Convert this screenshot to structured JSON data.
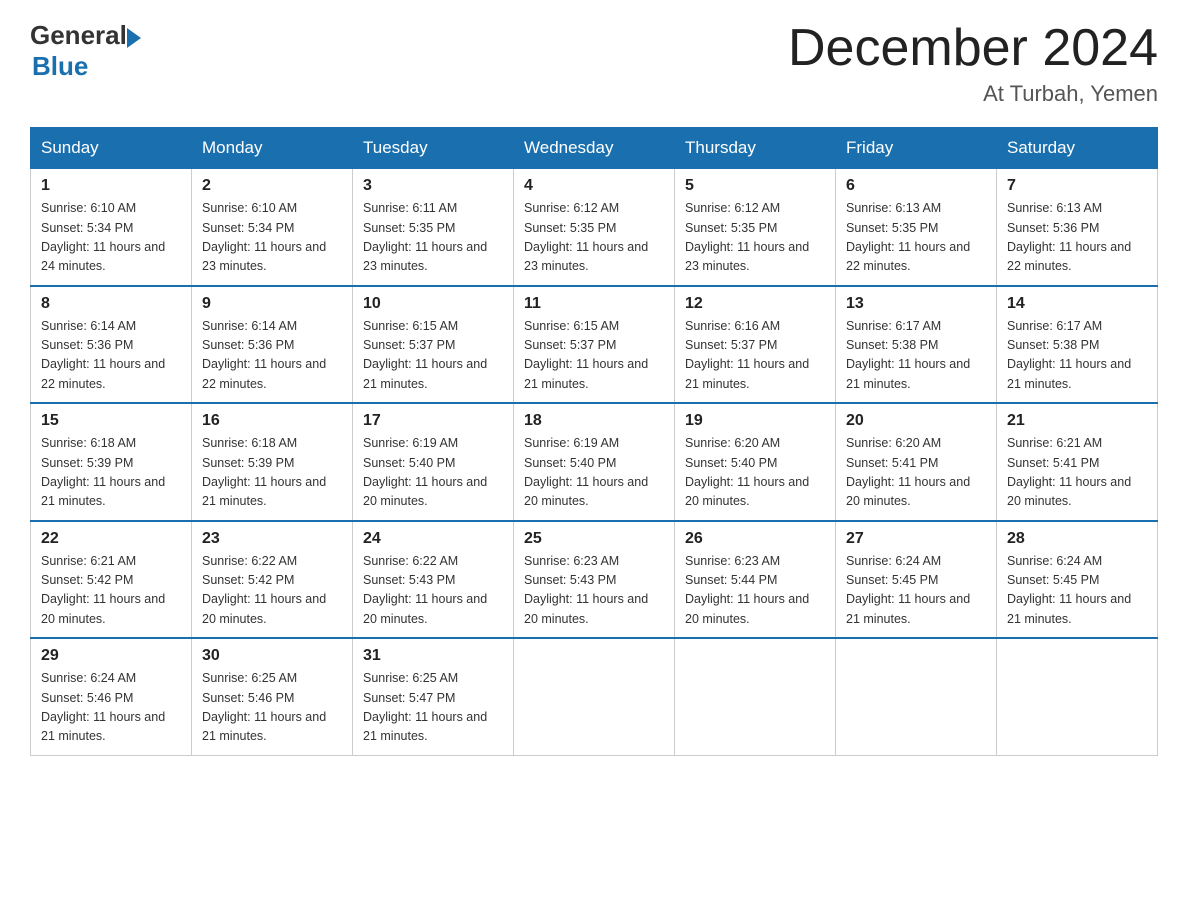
{
  "header": {
    "logo_general": "General",
    "logo_blue": "Blue",
    "month_title": "December 2024",
    "location": "At Turbah, Yemen"
  },
  "days_of_week": [
    "Sunday",
    "Monday",
    "Tuesday",
    "Wednesday",
    "Thursday",
    "Friday",
    "Saturday"
  ],
  "weeks": [
    [
      {
        "day": "1",
        "sunrise": "6:10 AM",
        "sunset": "5:34 PM",
        "daylight": "11 hours and 24 minutes."
      },
      {
        "day": "2",
        "sunrise": "6:10 AM",
        "sunset": "5:34 PM",
        "daylight": "11 hours and 23 minutes."
      },
      {
        "day": "3",
        "sunrise": "6:11 AM",
        "sunset": "5:35 PM",
        "daylight": "11 hours and 23 minutes."
      },
      {
        "day": "4",
        "sunrise": "6:12 AM",
        "sunset": "5:35 PM",
        "daylight": "11 hours and 23 minutes."
      },
      {
        "day": "5",
        "sunrise": "6:12 AM",
        "sunset": "5:35 PM",
        "daylight": "11 hours and 23 minutes."
      },
      {
        "day": "6",
        "sunrise": "6:13 AM",
        "sunset": "5:35 PM",
        "daylight": "11 hours and 22 minutes."
      },
      {
        "day": "7",
        "sunrise": "6:13 AM",
        "sunset": "5:36 PM",
        "daylight": "11 hours and 22 minutes."
      }
    ],
    [
      {
        "day": "8",
        "sunrise": "6:14 AM",
        "sunset": "5:36 PM",
        "daylight": "11 hours and 22 minutes."
      },
      {
        "day": "9",
        "sunrise": "6:14 AM",
        "sunset": "5:36 PM",
        "daylight": "11 hours and 22 minutes."
      },
      {
        "day": "10",
        "sunrise": "6:15 AM",
        "sunset": "5:37 PM",
        "daylight": "11 hours and 21 minutes."
      },
      {
        "day": "11",
        "sunrise": "6:15 AM",
        "sunset": "5:37 PM",
        "daylight": "11 hours and 21 minutes."
      },
      {
        "day": "12",
        "sunrise": "6:16 AM",
        "sunset": "5:37 PM",
        "daylight": "11 hours and 21 minutes."
      },
      {
        "day": "13",
        "sunrise": "6:17 AM",
        "sunset": "5:38 PM",
        "daylight": "11 hours and 21 minutes."
      },
      {
        "day": "14",
        "sunrise": "6:17 AM",
        "sunset": "5:38 PM",
        "daylight": "11 hours and 21 minutes."
      }
    ],
    [
      {
        "day": "15",
        "sunrise": "6:18 AM",
        "sunset": "5:39 PM",
        "daylight": "11 hours and 21 minutes."
      },
      {
        "day": "16",
        "sunrise": "6:18 AM",
        "sunset": "5:39 PM",
        "daylight": "11 hours and 21 minutes."
      },
      {
        "day": "17",
        "sunrise": "6:19 AM",
        "sunset": "5:40 PM",
        "daylight": "11 hours and 20 minutes."
      },
      {
        "day": "18",
        "sunrise": "6:19 AM",
        "sunset": "5:40 PM",
        "daylight": "11 hours and 20 minutes."
      },
      {
        "day": "19",
        "sunrise": "6:20 AM",
        "sunset": "5:40 PM",
        "daylight": "11 hours and 20 minutes."
      },
      {
        "day": "20",
        "sunrise": "6:20 AM",
        "sunset": "5:41 PM",
        "daylight": "11 hours and 20 minutes."
      },
      {
        "day": "21",
        "sunrise": "6:21 AM",
        "sunset": "5:41 PM",
        "daylight": "11 hours and 20 minutes."
      }
    ],
    [
      {
        "day": "22",
        "sunrise": "6:21 AM",
        "sunset": "5:42 PM",
        "daylight": "11 hours and 20 minutes."
      },
      {
        "day": "23",
        "sunrise": "6:22 AM",
        "sunset": "5:42 PM",
        "daylight": "11 hours and 20 minutes."
      },
      {
        "day": "24",
        "sunrise": "6:22 AM",
        "sunset": "5:43 PM",
        "daylight": "11 hours and 20 minutes."
      },
      {
        "day": "25",
        "sunrise": "6:23 AM",
        "sunset": "5:43 PM",
        "daylight": "11 hours and 20 minutes."
      },
      {
        "day": "26",
        "sunrise": "6:23 AM",
        "sunset": "5:44 PM",
        "daylight": "11 hours and 20 minutes."
      },
      {
        "day": "27",
        "sunrise": "6:24 AM",
        "sunset": "5:45 PM",
        "daylight": "11 hours and 21 minutes."
      },
      {
        "day": "28",
        "sunrise": "6:24 AM",
        "sunset": "5:45 PM",
        "daylight": "11 hours and 21 minutes."
      }
    ],
    [
      {
        "day": "29",
        "sunrise": "6:24 AM",
        "sunset": "5:46 PM",
        "daylight": "11 hours and 21 minutes."
      },
      {
        "day": "30",
        "sunrise": "6:25 AM",
        "sunset": "5:46 PM",
        "daylight": "11 hours and 21 minutes."
      },
      {
        "day": "31",
        "sunrise": "6:25 AM",
        "sunset": "5:47 PM",
        "daylight": "11 hours and 21 minutes."
      },
      null,
      null,
      null,
      null
    ]
  ]
}
